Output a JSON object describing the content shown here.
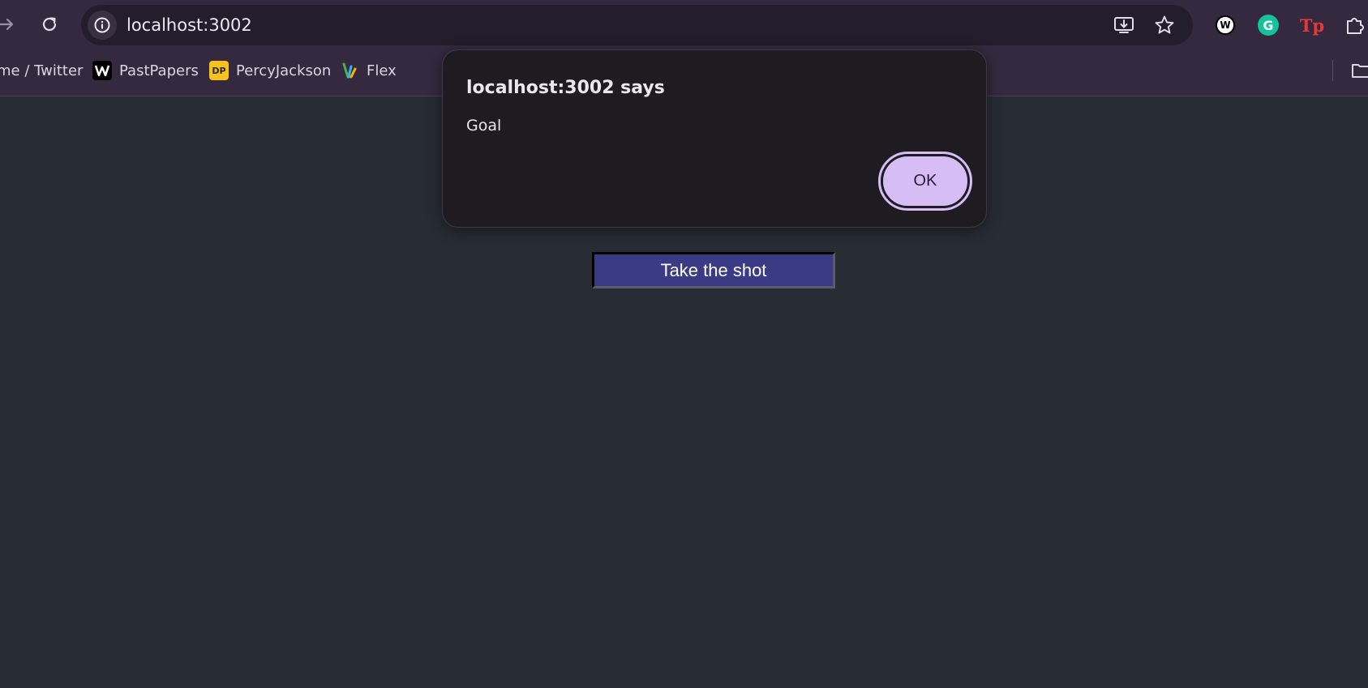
{
  "browser": {
    "url": "localhost:3002",
    "bookmarks": [
      {
        "label": "me / Twitter",
        "icon": "twitter-icon"
      },
      {
        "label": "PastPapers",
        "icon": "pastpapers-icon"
      },
      {
        "label": "PercyJackson",
        "icon": "dp-icon",
        "favicon_text": "DP"
      },
      {
        "label": "Flex",
        "icon": "flex-icon"
      }
    ],
    "extensions": [
      "wordtune-icon",
      "grammarly-icon",
      "tp-icon",
      "extensions-puzzle-icon"
    ],
    "extension_text": {
      "wordtune": "W",
      "grammarly": "G",
      "tp": "Tp"
    }
  },
  "dialog": {
    "title": "localhost:3002 says",
    "message": "Goal",
    "ok_label": "OK"
  },
  "page": {
    "button_label": "Take the shot"
  },
  "colors": {
    "toolbar": "#35293f",
    "page_background": "#282c34",
    "dialog_background": "#1e1c21",
    "ok_button": "#d7bdf6",
    "shot_button": "#3a3a85"
  }
}
